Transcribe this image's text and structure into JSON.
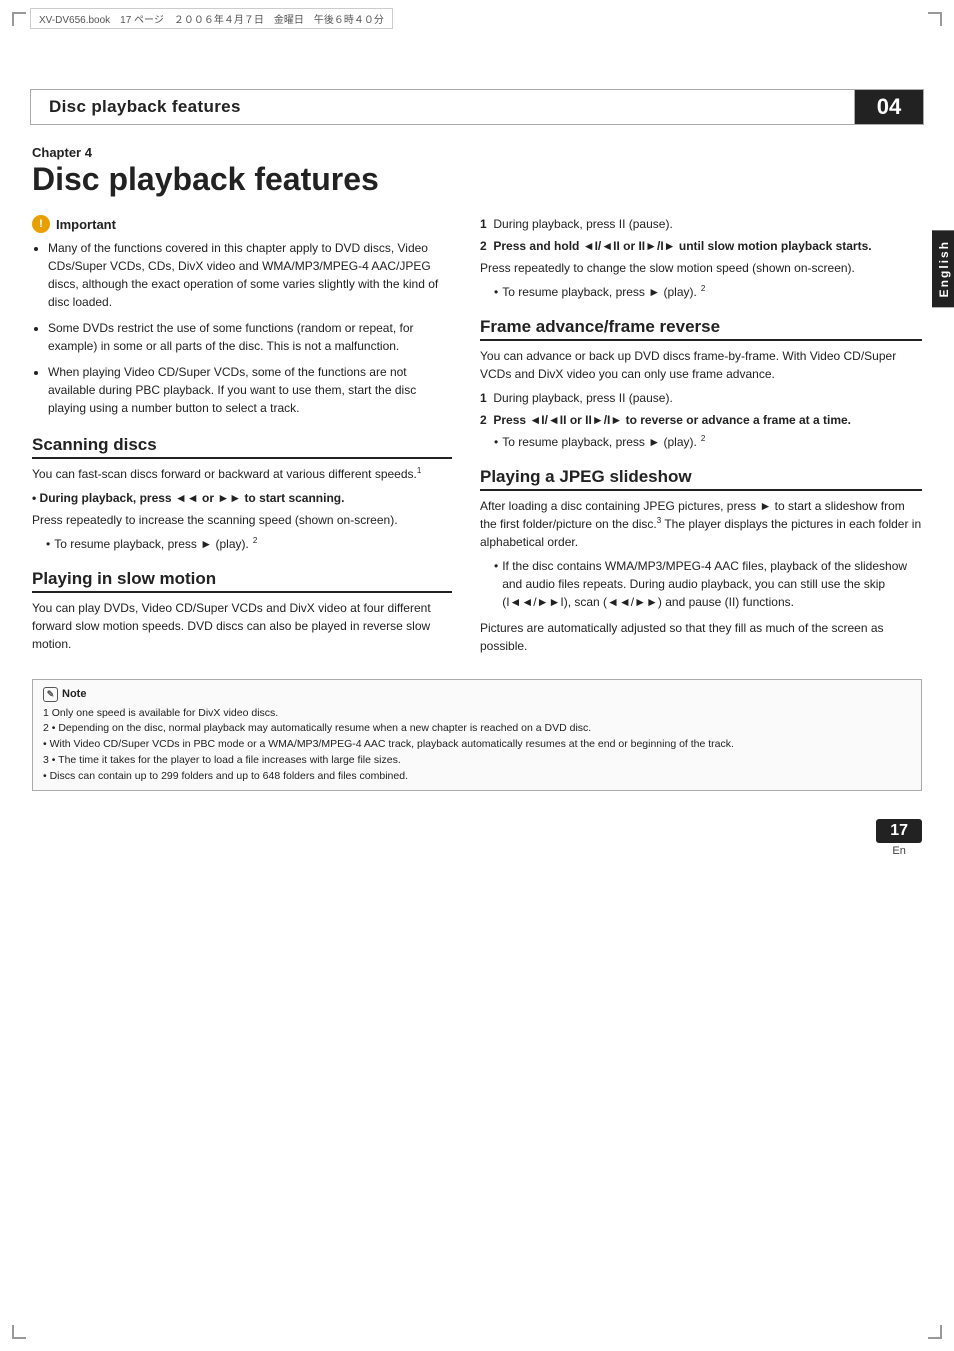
{
  "page": {
    "jp_header": "XV-DV656.book　17 ページ　２００６年４月７日　金曜日　午後６時４０分",
    "header_title": "Disc playback features",
    "chapter_badge": "04",
    "english_tab": "English",
    "chapter_label": "Chapter 4",
    "chapter_title": "Disc playback features",
    "page_number": "17",
    "page_lang": "En"
  },
  "important": {
    "title": "Important",
    "items": [
      "Many of the functions covered in this chapter apply to DVD discs, Video CDs/Super VCDs, CDs, DivX video and WMA/MP3/MPEG-4 AAC/JPEG discs, although the exact operation of some varies slightly with the kind of disc loaded.",
      "Some DVDs restrict the use of some functions (random or repeat, for example) in some or all parts of the disc. This is not a malfunction.",
      "When playing Video CD/Super VCDs, some of the functions are not available during PBC playback. If you want to use them, start the disc playing using a number button to select a track."
    ]
  },
  "scanning": {
    "title": "Scanning discs",
    "body": "You can fast-scan discs forward or backward at various different speeds.",
    "footnote": "1",
    "step_bold": "During playback, press ◄◄ or ►► to start scanning.",
    "step_body": "Press repeatedly to increase the scanning speed (shown on-screen).",
    "bullet": "To resume playback, press ► (play).",
    "bullet_footnote": "2"
  },
  "slow_motion": {
    "title": "Playing in slow motion",
    "body": "You can play DVDs, Video CD/Super VCDs and DivX video at four different forward slow motion speeds. DVD discs can also be played in reverse slow motion.",
    "step1_num": "1",
    "step1": "During playback, press II (pause).",
    "step2_num": "2",
    "step2_bold": "Press and hold ◄I/◄II or II►/I► until slow motion playback starts.",
    "step2_body": "Press repeatedly to change the slow motion speed (shown on-screen).",
    "bullet": "To resume playback, press ► (play).",
    "bullet_footnote": "2"
  },
  "frame_advance": {
    "title": "Frame advance/frame reverse",
    "body": "You can advance or back up DVD discs frame-by-frame. With Video CD/Super VCDs and DivX video you can only use frame advance.",
    "step1_num": "1",
    "step1": "During playback, press II (pause).",
    "step2_num": "2",
    "step2_bold": "Press ◄I/◄II or II►/I► to reverse or advance a frame at a time.",
    "bullet": "To resume playback, press ► (play).",
    "bullet_footnote": "2"
  },
  "jpeg_slideshow": {
    "title": "Playing a JPEG slideshow",
    "body1": "After loading a disc containing JPEG pictures, press ► to start a slideshow from the first folder/picture on the disc.",
    "body1_footnote": "3",
    "body1_cont": " The player displays the pictures in each folder in alphabetical order.",
    "bullet": "If the disc contains WMA/MP3/MPEG-4 AAC files, playback of the slideshow and audio files repeats. During audio playback, you can still use the skip (I◄◄/►►I), scan (◄◄/►►) and pause (II) functions.",
    "body2": "Pictures are automatically adjusted so that they fill as much of the screen as possible."
  },
  "notes": {
    "title": "Note",
    "items": [
      "1  Only one speed is available for DivX video discs.",
      "2  • Depending on the disc, normal playback may automatically resume when a new chapter is reached on a DVD disc.",
      "   • With Video CD/Super VCDs in PBC mode or a WMA/MP3/MPEG-4 AAC track, playback automatically resumes at the end or beginning of the track.",
      "3  • The time it takes for the player to load a file increases with large file sizes.",
      "   • Discs can contain up to 299 folders and up to 648 folders and files combined."
    ]
  }
}
